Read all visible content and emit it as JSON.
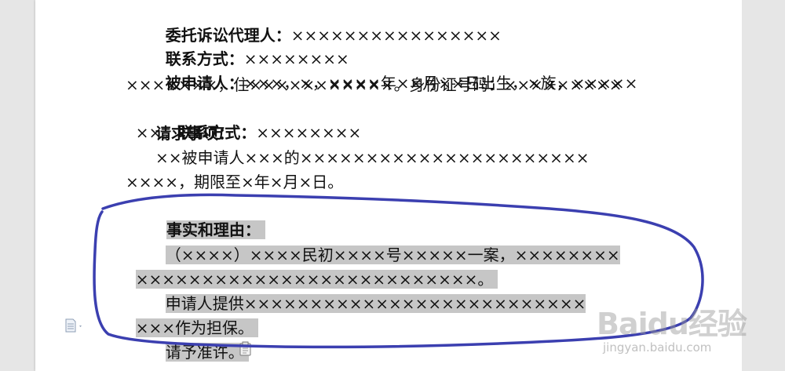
{
  "document": {
    "agent_label": "委托诉讼代理人：",
    "agent_value": "××××××××××××××××",
    "agent_contact_label": "联系方式：",
    "agent_contact_value": "××××××××",
    "respondent_label": "被申请人：",
    "respondent_line1_rest": "×××，×，××××年××月××日出生，×族，×××××",
    "respondent_line2": "×××××××，住×××××××××××。身份证号码：×××××××××",
    "respondent_line3_pre": "××。",
    "respondent_contact_label": "联系方式：",
    "respondent_contact_value": "××××××××",
    "request_heading": "请求事项：",
    "request_line1": "××被申请人×××的××××××××××××××××××××××",
    "request_line2": "××××，期限至×年×月×日。",
    "facts_heading": "事实和理由：",
    "facts_line1": "（××××）××××民初××××号×××××一案，××××××××",
    "facts_line2": "××××××××××××××××××××××××××。",
    "guarantee_line1": "申请人提供××××××××××××××××××××××××××",
    "guarantee_line2": "×××作为担保。",
    "closing_line": "请予准许。"
  },
  "watermark": {
    "logo_text": "Baidu经验",
    "sub_text": "jingyan.baidu.com"
  },
  "colors": {
    "highlight": "#c6c6c6",
    "annotation_ink": "#3b3fb0",
    "page_bg": "#ffffff",
    "workspace_bg": "#e6e6e6"
  },
  "icons": {
    "paragraph_options": "document-icon",
    "paste_options": "clipboard-icon"
  }
}
